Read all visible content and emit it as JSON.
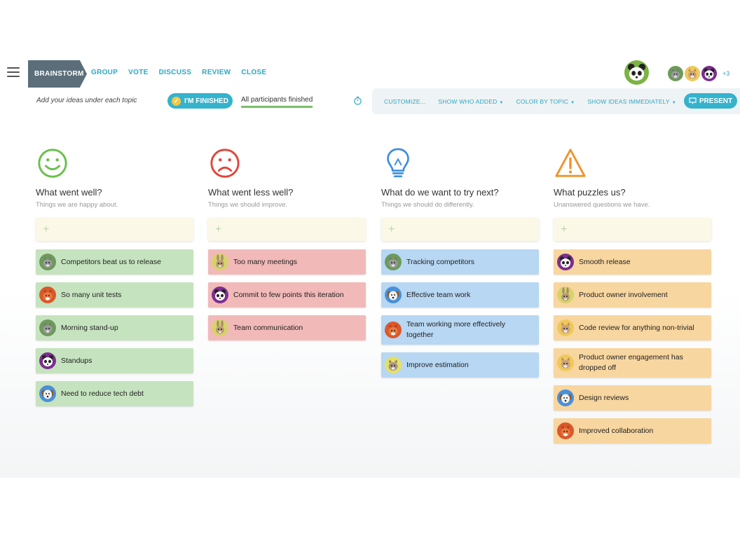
{
  "nav": {
    "steps": [
      "BRAINSTORM",
      "GROUP",
      "VOTE",
      "DISCUSS",
      "REVIEW",
      "CLOSE"
    ],
    "active_step": "BRAINSTORM",
    "more_participants": "+3"
  },
  "subbar": {
    "hint": "Add your ideas under each topic",
    "finished_button": "I'M FINISHED",
    "all_finished": "All participants finished"
  },
  "toolbar": {
    "customize": "CUSTOMIZE...",
    "show_who_added": "SHOW WHO ADDED",
    "color_by_topic": "COLOR BY TOPIC",
    "show_ideas": "SHOW IDEAS IMMEDIATELY",
    "present": "PRESENT"
  },
  "colors": {
    "accent": "#35b3cc",
    "green_card": "#c6e3bf",
    "red_card": "#f2b9b9",
    "blue_card": "#b7d7f3",
    "orange_card": "#f8d6a0"
  },
  "columns": [
    {
      "icon": "smiley-icon",
      "title": "What went well?",
      "subtitle": "Things we are happy about.",
      "cards": [
        {
          "text": "Competitors beat us to release",
          "avatar": "wolf"
        },
        {
          "text": "So many unit tests",
          "avatar": "fox"
        },
        {
          "text": "Morning stand-up",
          "avatar": "wolf"
        },
        {
          "text": "Standups",
          "avatar": "panda"
        },
        {
          "text": "Need to reduce tech debt",
          "avatar": "dog"
        }
      ]
    },
    {
      "icon": "frown-icon",
      "title": "What went less well?",
      "subtitle": "Things we should improve.",
      "cards": [
        {
          "text": "Too many meetings",
          "avatar": "rabbit"
        },
        {
          "text": "Commit to few points this iteration",
          "avatar": "panda"
        },
        {
          "text": "Team communication",
          "avatar": "rabbit"
        }
      ]
    },
    {
      "icon": "lightbulb-icon",
      "title": "What do we want to try next?",
      "subtitle": "Things we should do differently.",
      "cards": [
        {
          "text": "Tracking competitors",
          "avatar": "wolf"
        },
        {
          "text": "Effective team work",
          "avatar": "dog"
        },
        {
          "text": "Team working more effectively together",
          "avatar": "fox"
        },
        {
          "text": "Improve estimation",
          "avatar": "cat"
        }
      ]
    },
    {
      "icon": "warning-icon",
      "title": "What puzzles us?",
      "subtitle": "Unanswered questions we have.",
      "cards": [
        {
          "text": "Smooth release",
          "avatar": "panda"
        },
        {
          "text": "Product owner involvement",
          "avatar": "rabbit"
        },
        {
          "text": "Code review for anything non-trivial",
          "avatar": "cat"
        },
        {
          "text": "Product owner engagement has dropped off",
          "avatar": "cat"
        },
        {
          "text": "Design reviews",
          "avatar": "dog"
        },
        {
          "text": "Improved collaboration",
          "avatar": "fox"
        }
      ]
    }
  ]
}
